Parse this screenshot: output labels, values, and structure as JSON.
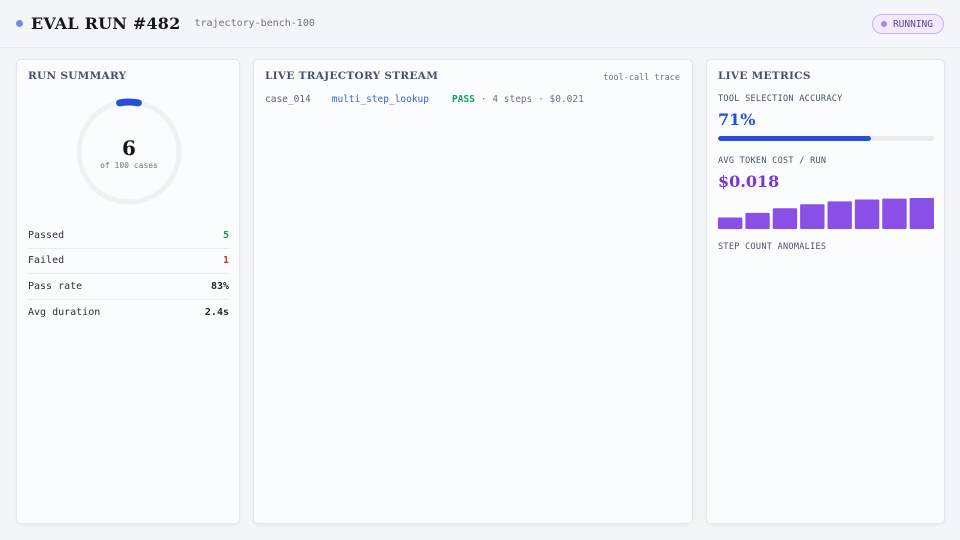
{
  "header": {
    "title": "EVAL RUN #482",
    "benchmark": "trajectory-bench-100",
    "status": "RUNNING"
  },
  "summary": {
    "title": "RUN SUMMARY",
    "completed": "6",
    "completed_num": 6,
    "total_num": 100,
    "total_label": "of 100 cases",
    "stats": [
      {
        "label": "Passed",
        "value": "5",
        "tone": "pass"
      },
      {
        "label": "Failed",
        "value": "1",
        "tone": "fail"
      },
      {
        "label": "Pass rate",
        "value": "83%",
        "tone": "plain"
      },
      {
        "label": "Avg duration",
        "value": "2.4s",
        "tone": "plain"
      }
    ]
  },
  "stream": {
    "title": "LIVE TRAJECTORY STREAM",
    "tag": "tool-call trace",
    "rows": [
      {
        "case": "case_014",
        "tool": "multi_step_lookup",
        "result": "PASS",
        "meta": "· 4 steps · $0.021"
      }
    ]
  },
  "metrics": {
    "title": "LIVE METRICS",
    "accuracy_label": "TOOL SELECTION ACCURACY",
    "accuracy_value": "71%",
    "accuracy_fraction": 0.71,
    "cost_label": "AVG TOKEN COST / RUN",
    "cost_value": "$0.018",
    "cost_bars": [
      0.37,
      0.52,
      0.67,
      0.8,
      0.89,
      0.95,
      0.98,
      1.0
    ],
    "anomalies_label": "STEP COUNT ANOMALIES"
  },
  "colors": {
    "accent_blue": "#2350d6",
    "accent_purple": "#7b35d6",
    "pass": "#1a9a5c",
    "fail": "#d0342c",
    "running_badge": "#a68bdc"
  },
  "icons": [
    "live-dot-icon",
    "status-dot-icon"
  ]
}
